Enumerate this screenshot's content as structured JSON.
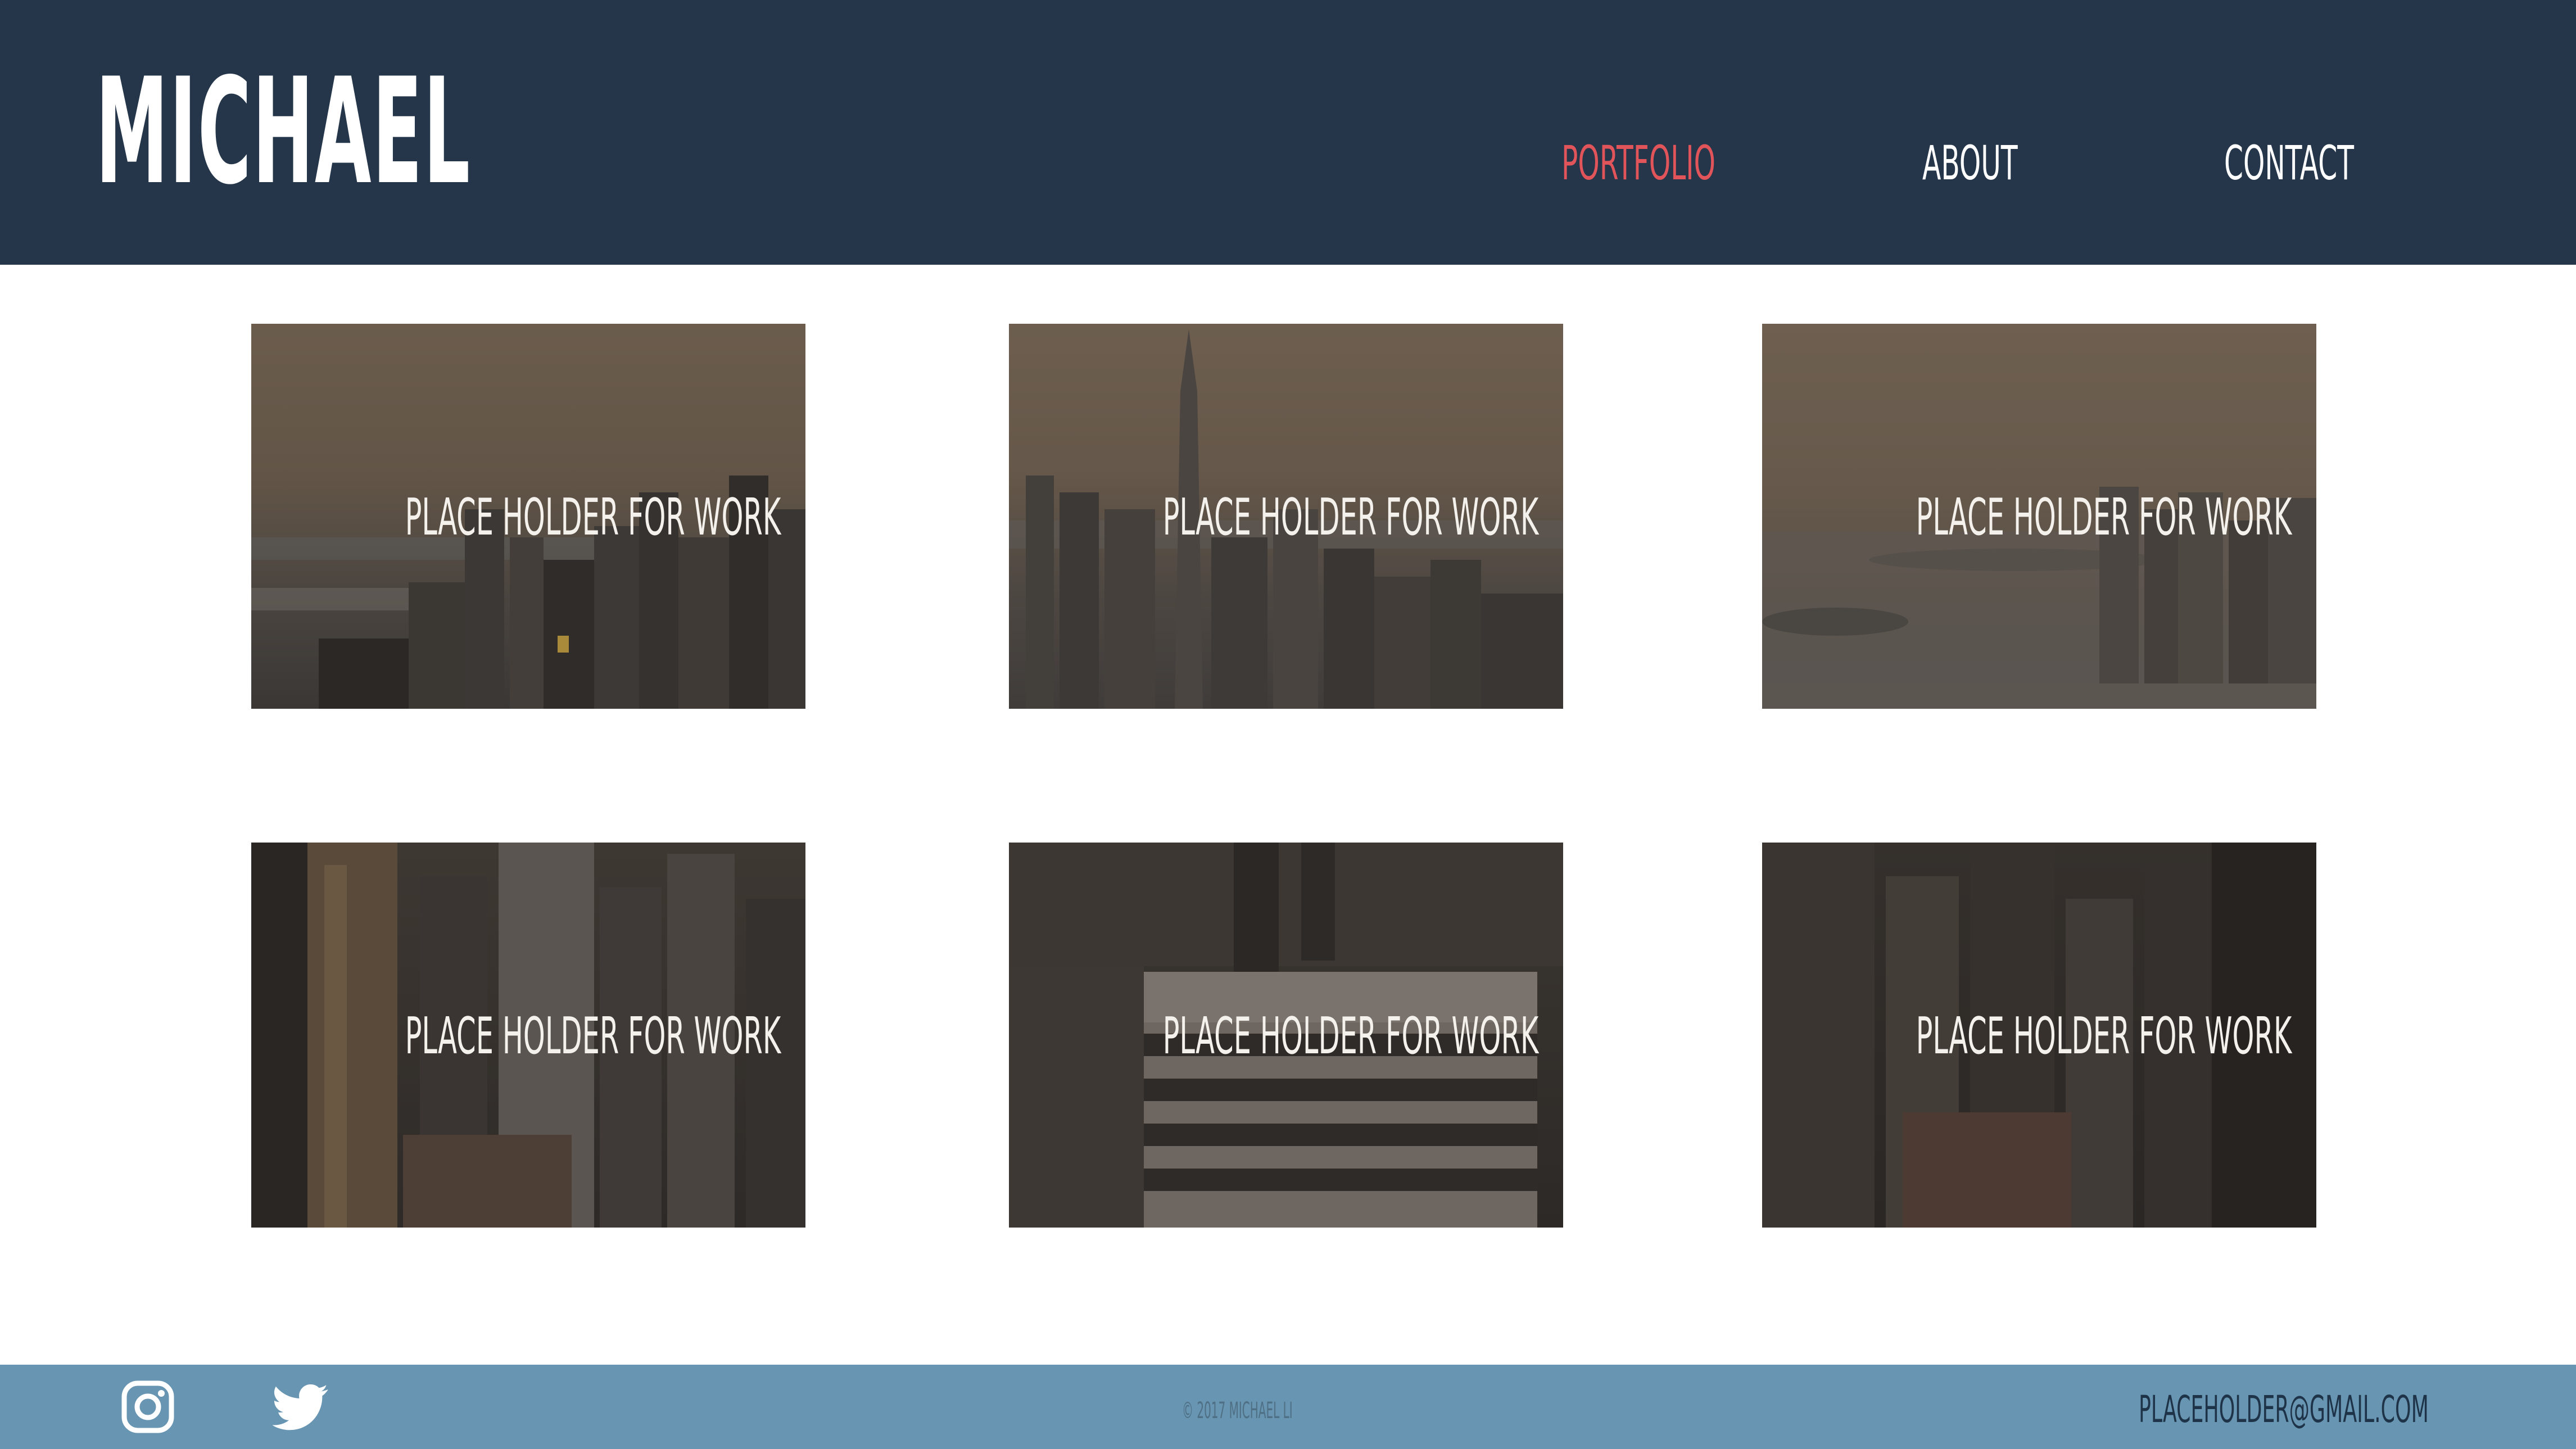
{
  "brand": {
    "name": "MICHAEL"
  },
  "nav": {
    "items": [
      {
        "label": "PORTFOLIO",
        "active": true
      },
      {
        "label": "ABOUT",
        "active": false
      },
      {
        "label": "CONTACT",
        "active": false
      }
    ],
    "active_color": "#e0545a"
  },
  "portfolio": {
    "tiles": [
      {
        "caption": "PLACE HOLDER FOR WORK"
      },
      {
        "caption": "PLACE HOLDER FOR WORK"
      },
      {
        "caption": "PLACE HOLDER FOR WORK"
      },
      {
        "caption": "PLACE HOLDER FOR WORK"
      },
      {
        "caption": "PLACE HOLDER FOR WORK"
      },
      {
        "caption": "PLACE HOLDER FOR WORK"
      }
    ]
  },
  "footer": {
    "social": [
      {
        "icon": "instagram-icon"
      },
      {
        "icon": "twitter-icon"
      }
    ],
    "copyright": "© 2017 MICHAEL LI",
    "email": "PLACEHOLDER@GMAIL.COM"
  },
  "colors": {
    "header_bg": "#25364a",
    "footer_bg": "#6795b2",
    "text_light": "#ffffff"
  }
}
